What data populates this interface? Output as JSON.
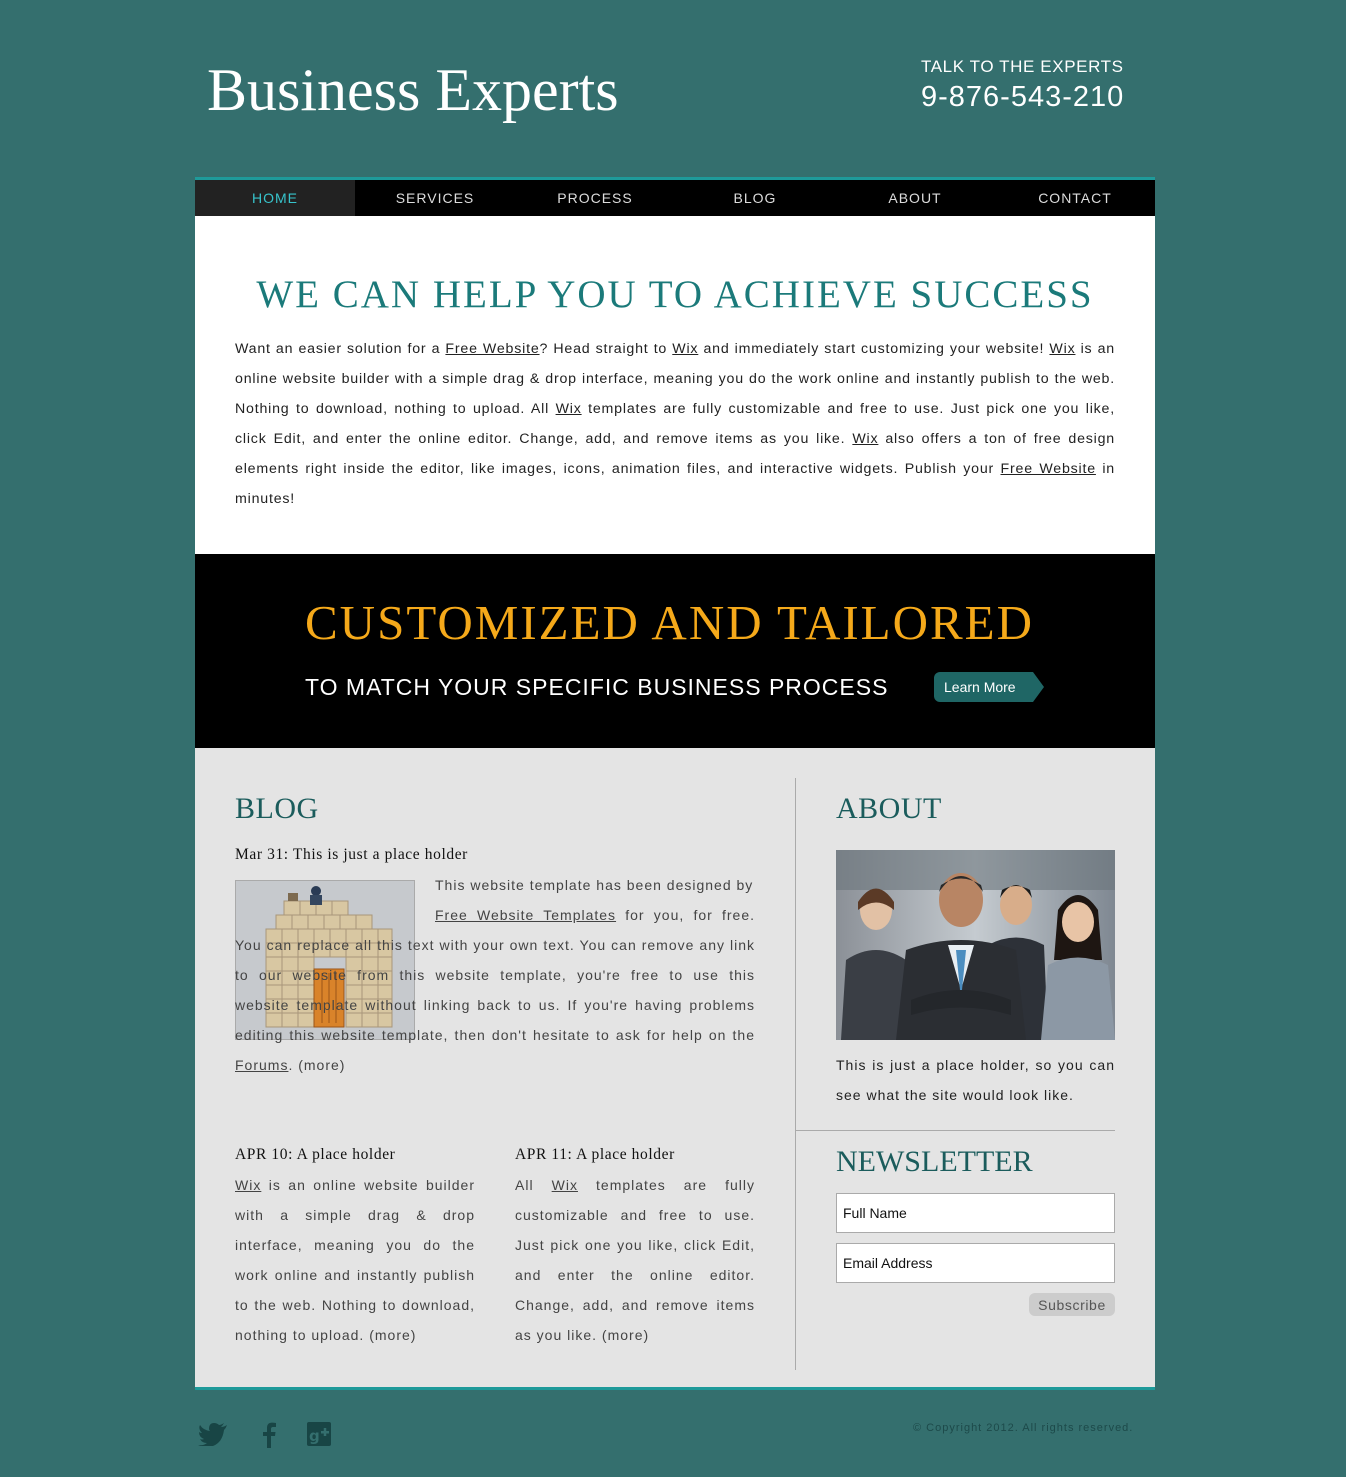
{
  "header": {
    "logo": "Business Experts",
    "talk_label": "TALK TO THE EXPERTS",
    "phone": "9-876-543-210"
  },
  "nav": [
    "HOME",
    "SERVICES",
    "PROCESS",
    "BLOG",
    "ABOUT",
    "CONTACT"
  ],
  "hero": {
    "title": "WE CAN HELP YOU TO ACHIEVE SUCCESS",
    "p": [
      "Want an easier solution for a ",
      "Free Website",
      "? Head straight to ",
      "Wix",
      " and immediately start customizing your website! ",
      "Wix",
      " is an online website builder with a simple drag & drop interface, meaning you do the work online and instantly publish to the web. Nothing to download, nothing to upload. All ",
      "Wix",
      " templates are fully customizable and free to use. Just pick one you like, click Edit, and enter the online editor. Change, add, and remove items as you like. ",
      "Wix",
      " also offers a ton of free design elements right inside the editor, like images, icons, animation files, and interactive widgets. Publish your ",
      "Free Website",
      " in minutes!"
    ]
  },
  "banner": {
    "title": "CUSTOMIZED AND TAILORED",
    "subtitle": "TO MATCH YOUR SPECIFIC BUSINESS PROCESS",
    "button": "Learn More"
  },
  "blog": {
    "title": "BLOG",
    "post1": {
      "title": "Mar 31: This is just a place holder",
      "t1": "This website template has been designed by ",
      "link1": "Free Website Templates",
      "t2": " for you, for free. You can replace all this text with your own text. You can remove any link to our website from this website template, you're free to use this website template without linking back to us. If you're having problems editing this website template, then don't hesitate to ask for help on the ",
      "link2": "Forums",
      "t3": ". (more)"
    },
    "post2": {
      "title": "APR 10: A place holder",
      "link": "Wix",
      "text": " is an online website builder with a simple drag & drop interface, meaning you do the work online and instantly publish to the web. Nothing to download, nothing to upload. (more)"
    },
    "post3": {
      "title": "APR 11: A place holder",
      "t1": "All ",
      "link": "Wix",
      "t2": " templates are fully customizable and free to use. Just pick one you like, click Edit, and enter the online editor. Change, add, and remove items as you like. (more)"
    }
  },
  "about": {
    "title": "ABOUT",
    "text": "This is just a place holder, so you can see what the site would look like."
  },
  "newsletter": {
    "title": "NEWSLETTER",
    "name_placeholder": "Full Name",
    "email_placeholder": "Email Address",
    "button": "Subscribe"
  },
  "footer": {
    "copyright": "© Copyright 2012. All rights reserved.",
    "social": [
      "twitter-icon",
      "facebook-icon",
      "google-plus-icon"
    ]
  }
}
